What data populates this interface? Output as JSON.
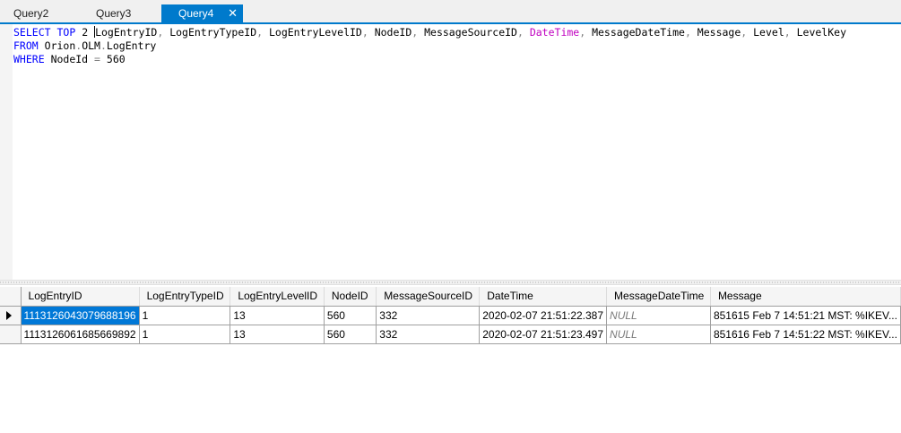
{
  "tabs": [
    {
      "label": "Query2",
      "active": false
    },
    {
      "label": "Query3",
      "active": false
    },
    {
      "label": "Query4",
      "active": true
    }
  ],
  "tab_close_glyph": "✕",
  "accent_color": "#007acc",
  "editor": {
    "line1": {
      "select": "SELECT",
      "top": "TOP",
      "n": "2",
      "cols_a": "LogEntryID",
      "cols_b": "LogEntryTypeID",
      "cols_c": "LogEntryLevelID",
      "cols_d": "NodeID",
      "cols_e": "MessageSourceID",
      "cols_f": "DateTime",
      "cols_g": "MessageDateTime",
      "cols_h": "Message",
      "cols_i": "Level",
      "cols_j": "LevelKey"
    },
    "line2": {
      "from": "FROM",
      "db": "Orion",
      "schema": "OLM",
      "table": "LogEntry"
    },
    "line3": {
      "where": "WHERE",
      "col": "NodeId",
      "op": "=",
      "value": "560"
    }
  },
  "results": {
    "columns": [
      "LogEntryID",
      "LogEntryTypeID",
      "LogEntryLevelID",
      "NodeID",
      "MessageSourceID",
      "DateTime",
      "MessageDateTime",
      "Message"
    ],
    "rows": [
      [
        "1113126043079688196",
        "1",
        "13",
        "560",
        "332",
        "2020-02-07 21:51:22.387",
        "NULL",
        "851615 Feb  7 14:51:21 MST: %IKEV..."
      ],
      [
        "1113126061685669892",
        "1",
        "13",
        "560",
        "332",
        "2020-02-07 21:51:23.497",
        "NULL",
        "851616 Feb  7 14:51:22 MST: %IKEV..."
      ]
    ]
  }
}
